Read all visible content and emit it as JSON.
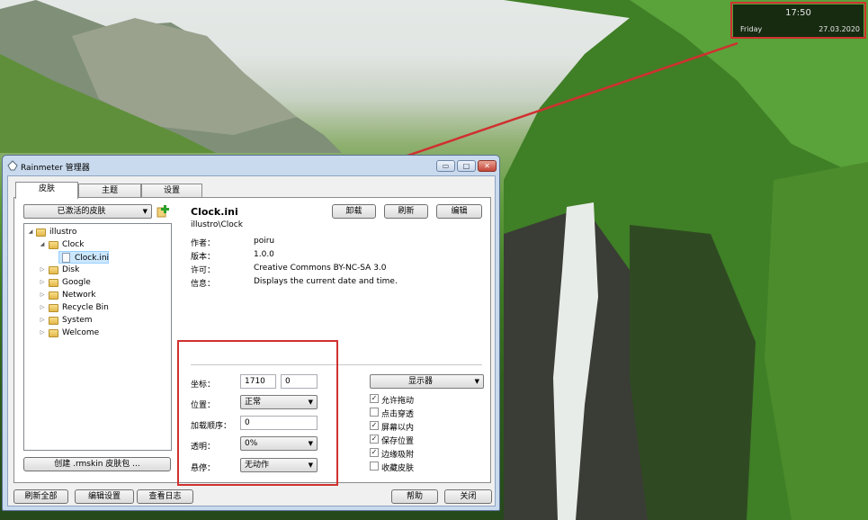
{
  "desktop": {
    "clock": {
      "time": "17:50",
      "day": "Friday",
      "date": "27.03.2020"
    }
  },
  "window": {
    "title": "Rainmeter 管理器",
    "controls": {
      "minimize": "▭",
      "maximize": "□",
      "close": "✕"
    },
    "tabs": [
      "皮肤",
      "主题",
      "设置"
    ],
    "skins": {
      "active_dropdown": "已激活的皮肤",
      "tree": [
        {
          "label": "illustro",
          "expanded": true
        },
        {
          "label": "Clock",
          "expanded": true
        },
        {
          "label": "Clock.ini",
          "selected": true
        },
        {
          "label": "Disk"
        },
        {
          "label": "Google"
        },
        {
          "label": "Network"
        },
        {
          "label": "Recycle Bin"
        },
        {
          "label": "System"
        },
        {
          "label": "Welcome"
        }
      ],
      "create_button": "创建 .rmskin 皮肤包 ..."
    },
    "detail": {
      "name": "Clock.ini",
      "path": "illustro\\Clock",
      "buttons": {
        "unload": "卸载",
        "refresh": "刷新",
        "edit": "编辑"
      },
      "info": [
        {
          "key": "作者：",
          "value": "poiru"
        },
        {
          "key": "版本：",
          "value": "1.0.0"
        },
        {
          "key": "许可：",
          "value": "Creative Commons BY-NC-SA 3.0"
        },
        {
          "key": "信息：",
          "value": "Displays the current date and time."
        }
      ]
    },
    "settings": {
      "coord_label": "坐标：",
      "coord_x": "1710",
      "coord_y": "0",
      "position_label": "位置：",
      "position_value": "正常",
      "load_order_label": "加载顺序：",
      "load_order_value": "0",
      "transparency_label": "透明：",
      "transparency_value": "0%",
      "hover_label": "悬停：",
      "hover_value": "无动作",
      "monitor_dropdown": "显示器",
      "checkboxes": [
        {
          "label": "允许拖动",
          "checked": true
        },
        {
          "label": "点击穿透",
          "checked": false
        },
        {
          "label": "屏幕以内",
          "checked": true
        },
        {
          "label": "保存位置",
          "checked": true
        },
        {
          "label": "边缘吸附",
          "checked": true
        },
        {
          "label": "收藏皮肤",
          "checked": false
        }
      ]
    },
    "footer": {
      "refresh_all": "刷新全部",
      "edit_settings": "编辑设置",
      "view_log": "查看日志",
      "help": "帮助",
      "close": "关闭"
    }
  },
  "colors": {
    "highlight": "#d03030",
    "window_frame": "#c9daee"
  }
}
